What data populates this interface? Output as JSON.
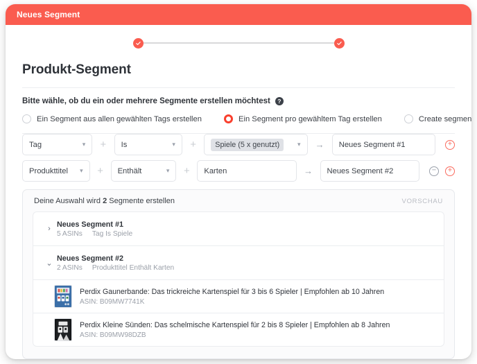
{
  "window": {
    "title": "Neues Segment",
    "accent_color": "#fa5c4f"
  },
  "stepper": {
    "step1_icon": "check-circle-icon",
    "step2_icon": "check-circle-icon"
  },
  "page": {
    "title": "Produkt-Segment",
    "prompt": "Bitte wähle, ob du ein oder mehrere Segmente erstellen möchtest",
    "help_icon": "?"
  },
  "radio_options": [
    {
      "label": "Ein Segment aus allen gewählten Tags erstellen",
      "selected": false
    },
    {
      "label": "Ein Segment pro gewähltem Tag erstellen",
      "selected": true
    },
    {
      "label": "Create segment for all Products",
      "selected": false
    }
  ],
  "separators": {
    "plus": "+",
    "arrow": "→"
  },
  "rules": [
    {
      "attribute": "Tag",
      "operator": "Is",
      "value": "Spiele (5 x genutzt)",
      "value_is_chip": true,
      "segment_name": "Neues Segment #1",
      "actions": [
        "add"
      ]
    },
    {
      "attribute": "Produkttitel",
      "operator": "Enthält",
      "value": "Karten",
      "value_is_chip": false,
      "segment_name": "Neues Segment #2",
      "actions": [
        "remove",
        "add"
      ]
    }
  ],
  "preview": {
    "summary_prefix": "Deine Auswahl wird",
    "summary_count": "2",
    "summary_suffix": "Segmente erstellen",
    "label": "VORSCHAU",
    "segments": [
      {
        "name": "Neues Segment #1",
        "asins": "5 ASINs",
        "condition": "Tag Is Spiele",
        "expanded": false,
        "caret": "chevron-right-icon"
      },
      {
        "name": "Neues Segment #2",
        "asins": "2 ASINs",
        "condition": "Produkttitel Enthält Karten",
        "expanded": true,
        "caret": "chevron-down-icon"
      }
    ],
    "products": [
      {
        "title": "Perdix Gaunerbande: Das trickreiche Kartenspiel für 3 bis 6 Spieler | Empfohlen ab 10 Jahren",
        "asin": "ASIN: B09MW7741K",
        "thumb_color": "#3b6fa8"
      },
      {
        "title": "Perdix Kleine Sünden: Das schelmische Kartenspiel für 2 bis 8 Spieler | Empfohlen ab 8 Jahren",
        "asin": "ASIN: B09MW98DZB",
        "thumb_color": "#16181a"
      }
    ]
  }
}
